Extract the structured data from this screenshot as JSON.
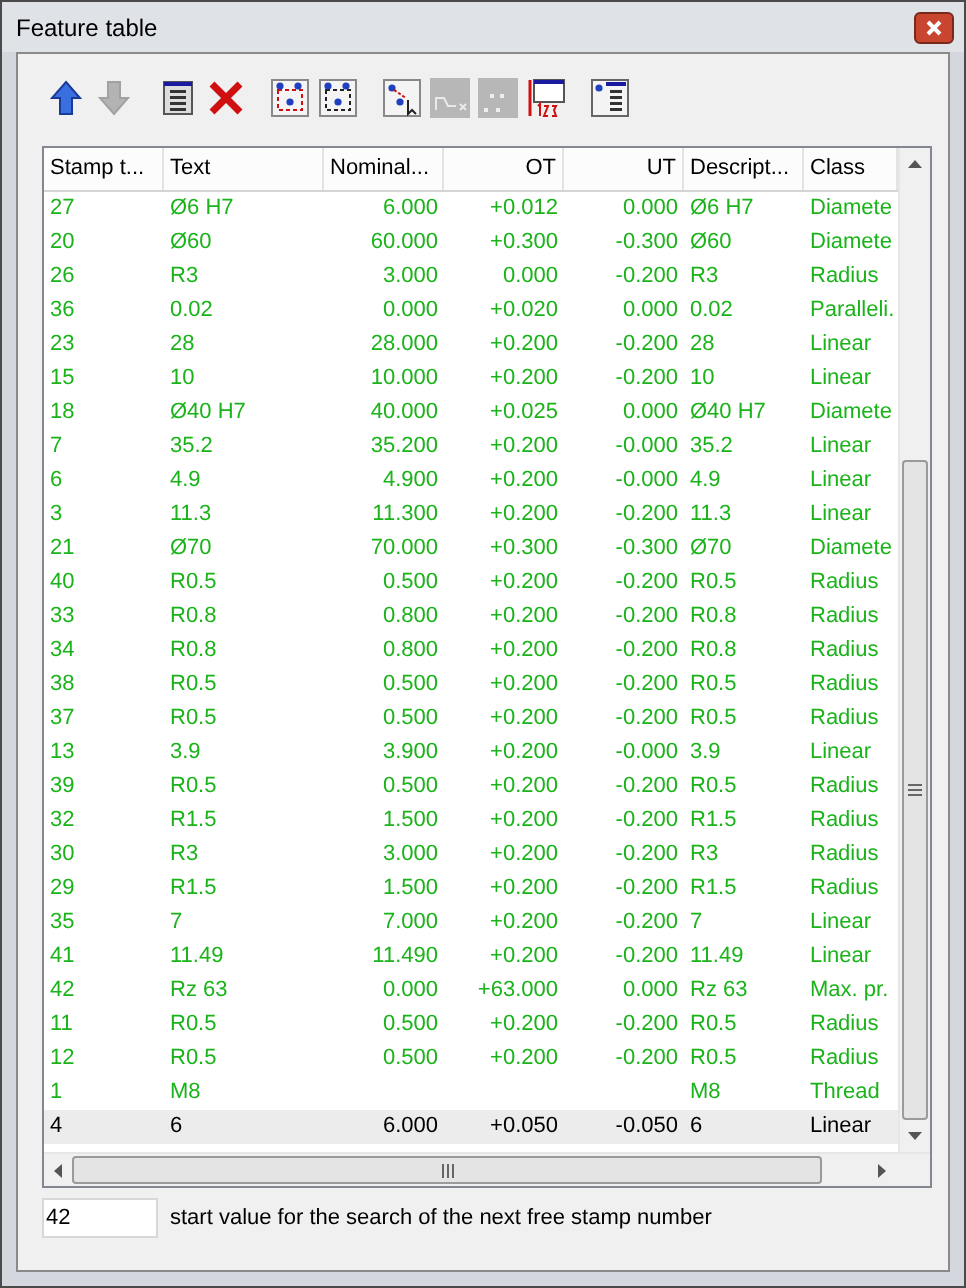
{
  "window": {
    "title": "Feature table"
  },
  "toolbar": {
    "groups": [
      [
        {
          "kind": "arrow-up",
          "disabled": false
        },
        {
          "kind": "arrow-down",
          "disabled": true
        }
      ],
      [
        {
          "kind": "columns",
          "disabled": false
        },
        {
          "kind": "delete",
          "disabled": false
        }
      ],
      [
        {
          "kind": "select-red",
          "disabled": false
        },
        {
          "kind": "select-black",
          "disabled": false
        }
      ],
      [
        {
          "kind": "pick",
          "disabled": false
        },
        {
          "kind": "curve",
          "disabled": true
        },
        {
          "kind": "dots",
          "disabled": true
        },
        {
          "kind": "numbering",
          "disabled": false
        }
      ],
      [
        {
          "kind": "column-settings",
          "disabled": false
        }
      ]
    ]
  },
  "table": {
    "columns": [
      "Stamp t...",
      "Text",
      "Nominal...",
      "OT",
      "UT",
      "Descript...",
      "Class"
    ],
    "rows": [
      {
        "selected": false,
        "cells": [
          "27",
          "Ø6 H7",
          "6.000",
          "+0.012",
          "0.000",
          "Ø6 H7",
          "Diamete"
        ]
      },
      {
        "selected": false,
        "cells": [
          "20",
          "Ø60",
          "60.000",
          "+0.300",
          "-0.300",
          "Ø60",
          "Diamete"
        ]
      },
      {
        "selected": false,
        "cells": [
          "26",
          "R3",
          "3.000",
          "0.000",
          "-0.200",
          "R3",
          "Radius"
        ]
      },
      {
        "selected": false,
        "cells": [
          "36",
          "0.02",
          "0.000",
          "+0.020",
          "0.000",
          "0.02",
          "Paralleli."
        ]
      },
      {
        "selected": false,
        "cells": [
          "23",
          "28",
          "28.000",
          "+0.200",
          "-0.200",
          "28",
          "Linear"
        ]
      },
      {
        "selected": false,
        "cells": [
          "15",
          "10",
          "10.000",
          "+0.200",
          "-0.200",
          "10",
          "Linear"
        ]
      },
      {
        "selected": false,
        "cells": [
          "18",
          "Ø40 H7",
          "40.000",
          "+0.025",
          "0.000",
          "Ø40 H7",
          "Diamete"
        ]
      },
      {
        "selected": false,
        "cells": [
          "7",
          "35.2",
          "35.200",
          "+0.200",
          "-0.000",
          "35.2",
          "Linear"
        ]
      },
      {
        "selected": false,
        "cells": [
          "6",
          "4.9",
          "4.900",
          "+0.200",
          "-0.000",
          "4.9",
          "Linear"
        ]
      },
      {
        "selected": false,
        "cells": [
          "3",
          "11.3",
          "11.300",
          "+0.200",
          "-0.200",
          "11.3",
          "Linear"
        ]
      },
      {
        "selected": false,
        "cells": [
          "21",
          "Ø70",
          "70.000",
          "+0.300",
          "-0.300",
          "Ø70",
          "Diamete"
        ]
      },
      {
        "selected": false,
        "cells": [
          "40",
          "R0.5",
          "0.500",
          "+0.200",
          "-0.200",
          "R0.5",
          "Radius"
        ]
      },
      {
        "selected": false,
        "cells": [
          "33",
          "R0.8",
          "0.800",
          "+0.200",
          "-0.200",
          "R0.8",
          "Radius"
        ]
      },
      {
        "selected": false,
        "cells": [
          "34",
          "R0.8",
          "0.800",
          "+0.200",
          "-0.200",
          "R0.8",
          "Radius"
        ]
      },
      {
        "selected": false,
        "cells": [
          "38",
          "R0.5",
          "0.500",
          "+0.200",
          "-0.200",
          "R0.5",
          "Radius"
        ]
      },
      {
        "selected": false,
        "cells": [
          "37",
          "R0.5",
          "0.500",
          "+0.200",
          "-0.200",
          "R0.5",
          "Radius"
        ]
      },
      {
        "selected": false,
        "cells": [
          "13",
          "3.9",
          "3.900",
          "+0.200",
          "-0.000",
          "3.9",
          "Linear"
        ]
      },
      {
        "selected": false,
        "cells": [
          "39",
          "R0.5",
          "0.500",
          "+0.200",
          "-0.200",
          "R0.5",
          "Radius"
        ]
      },
      {
        "selected": false,
        "cells": [
          "32",
          "R1.5",
          "1.500",
          "+0.200",
          "-0.200",
          "R1.5",
          "Radius"
        ]
      },
      {
        "selected": false,
        "cells": [
          "30",
          "R3",
          "3.000",
          "+0.200",
          "-0.200",
          "R3",
          "Radius"
        ]
      },
      {
        "selected": false,
        "cells": [
          "29",
          "R1.5",
          "1.500",
          "+0.200",
          "-0.200",
          "R1.5",
          "Radius"
        ]
      },
      {
        "selected": false,
        "cells": [
          "35",
          "7",
          "7.000",
          "+0.200",
          "-0.200",
          "7",
          "Linear"
        ]
      },
      {
        "selected": false,
        "cells": [
          "41",
          "11.49",
          "11.490",
          "+0.200",
          "-0.200",
          "11.49",
          "Linear"
        ]
      },
      {
        "selected": false,
        "cells": [
          "42",
          "Rz 63",
          "0.000",
          "+63.000",
          "0.000",
          "Rz 63",
          "Max. pr."
        ]
      },
      {
        "selected": false,
        "cells": [
          "11",
          "R0.5",
          "0.500",
          "+0.200",
          "-0.200",
          "R0.5",
          "Radius"
        ]
      },
      {
        "selected": false,
        "cells": [
          "12",
          "R0.5",
          "0.500",
          "+0.200",
          "-0.200",
          "R0.5",
          "Radius"
        ]
      },
      {
        "selected": false,
        "cells": [
          "1",
          "M8",
          null,
          null,
          null,
          "M8",
          "Thread"
        ]
      },
      {
        "selected": true,
        "cells": [
          "4",
          "6",
          "6.000",
          "+0.050",
          "-0.050",
          "6",
          "Linear"
        ]
      }
    ]
  },
  "start_value": {
    "value": "42",
    "label": "start value for the search of the next free stamp number"
  }
}
